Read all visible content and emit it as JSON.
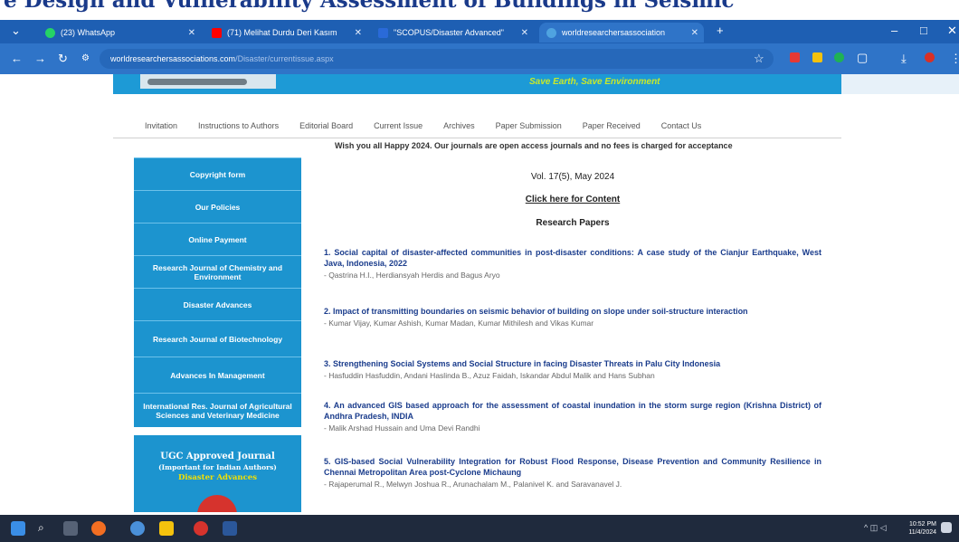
{
  "caption": "e Design and Vulnerability Assessment of Buildings in Seismic",
  "tabs": [
    {
      "title": "(23) WhatsApp",
      "fav_color": "#25d366"
    },
    {
      "title": "(71) Melihat Durdu Deri Kasım",
      "fav_color": "#ff0000"
    },
    {
      "title": "\"SCOPUS/Disaster Advanced\"",
      "fav_color": "#2a6ad8"
    },
    {
      "title": "worldresearchersassociation",
      "fav_color": "#4fa3e0"
    }
  ],
  "address": {
    "domain": "worldresearchersassociations.com",
    "path": "/Disaster/currentissue.aspx"
  },
  "banner": {
    "tagline": "Save Earth, Save Environment"
  },
  "menu": [
    "Invitation",
    "Instructions to Authors",
    "Editorial Board",
    "Current Issue",
    "Archives",
    "Paper Submission",
    "Paper Received",
    "Contact Us"
  ],
  "notice": "Wish you all Happy 2024. Our journals are open access journals and no fees is charged for acceptance",
  "sidebar": [
    "Copyright form",
    "Our Policies",
    "Online Payment",
    "Research Journal of Chemistry and Environment",
    "Disaster Advances",
    "Research Journal of Biotechnology",
    "Advances In Management",
    "International Res. Journal of Agricultural Sciences and Veterinary Medicine"
  ],
  "ugc": {
    "title": "UGC Approved Journal",
    "subtitle": "(Important for Indian Authors)",
    "journal": "Disaster Advances"
  },
  "content": {
    "volume": "Vol. 17(5), May 2024",
    "click_link": "Click here for Content",
    "section_title": "Research Papers",
    "papers": [
      {
        "title": "1. Social capital of disaster-affected communities in post-disaster conditions: A case study of the Cianjur Earthquake, West Java, Indonesia, 2022",
        "authors": "- Qastrina H.I., Herdiansyah Herdis and Bagus Aryo"
      },
      {
        "title": "2. Impact of transmitting boundaries on seismic behavior of building on slope under soil-structure interaction",
        "authors": "- Kumar Vijay, Kumar Ashish, Kumar Madan, Kumar Mithilesh and Vikas Kumar"
      },
      {
        "title": "3. Strengthening Social Systems and Social Structure in facing Disaster Threats in Palu City Indonesia",
        "authors": "- Hasfuddin Hasfuddin, Andani Haslinda B., Azuz Faidah, Iskandar Abdul Malik and Hans Subhan"
      },
      {
        "title": "4. An advanced GIS based approach for the assessment of coastal inundation in the storm surge region (Krishna District) of Andhra Pradesh, INDIA",
        "authors": "- Malik Arshad Hussain and Uma Devi Randhi"
      },
      {
        "title": "5. GIS-based Social Vulnerability Integration for Robust Flood Response, Disease Prevention and Community Resilience in Chennai Metropolitan Area post-Cyclone Michaung",
        "authors": "- Rajaperumal R., Melwyn Joshua R., Arunachalam M., Palanivel K. and Saravanavel J."
      }
    ]
  },
  "taskbar": {
    "time": "10:52 PM",
    "date": "11/4/2024"
  }
}
